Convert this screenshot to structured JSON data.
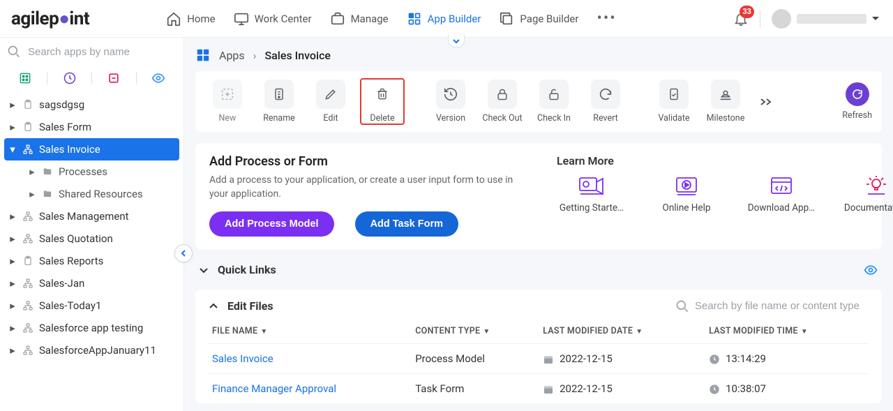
{
  "brand": {
    "name_a": "agilep",
    "name_b": "int"
  },
  "topnav": [
    {
      "key": "home",
      "label": "Home"
    },
    {
      "key": "workcenter",
      "label": "Work Center"
    },
    {
      "key": "manage",
      "label": "Manage"
    },
    {
      "key": "appbuilder",
      "label": "App Builder",
      "active": true
    },
    {
      "key": "pagebuilder",
      "label": "Page Builder"
    }
  ],
  "notifications": {
    "count": "33"
  },
  "sidebar": {
    "search_placeholder": "Search apps by name",
    "items": [
      {
        "label": "sagsdgsg"
      },
      {
        "label": "Sales Form"
      },
      {
        "label": "Sales Invoice",
        "selected": true,
        "expanded": true,
        "children": [
          {
            "label": "Processes"
          },
          {
            "label": "Shared Resources"
          }
        ]
      },
      {
        "label": "Sales Management"
      },
      {
        "label": "Sales Quotation"
      },
      {
        "label": "Sales Reports"
      },
      {
        "label": "Sales-Jan"
      },
      {
        "label": "Sales-Today1"
      },
      {
        "label": "Salesforce app testing"
      },
      {
        "label": "SalesforceAppJanuary11"
      }
    ]
  },
  "breadcrumb": {
    "root": "Apps",
    "current": "Sales Invoice"
  },
  "toolbar": {
    "new": "New",
    "rename": "Rename",
    "edit": "Edit",
    "delete": "Delete",
    "version": "Version",
    "checkout": "Check Out",
    "checkin": "Check In",
    "revert": "Revert",
    "validate": "Validate",
    "milestone": "Milestone",
    "refresh": "Refresh"
  },
  "add_section": {
    "title": "Add Process or Form",
    "desc": "Add a process to your application, or create a user input form to use in your application.",
    "btn_process": "Add Process Model",
    "btn_task": "Add Task Form"
  },
  "learn": {
    "title": "Learn More",
    "items": [
      {
        "label": "Getting Starte…"
      },
      {
        "label": "Online Help"
      },
      {
        "label": "Download App…"
      },
      {
        "label": "Documentation"
      }
    ]
  },
  "quicklinks": {
    "title": "Quick Links"
  },
  "files": {
    "title": "Edit Files",
    "search_placeholder": "Search by file name or content type",
    "cols": {
      "name": "FILE NAME",
      "type": "CONTENT TYPE",
      "date": "LAST MODIFIED DATE",
      "time": "LAST MODIFIED TIME"
    },
    "rows": [
      {
        "name": "Sales Invoice",
        "type": "Process Model",
        "date": "2022-12-15",
        "time": "13:14:29"
      },
      {
        "name": "Finance Manager Approval",
        "type": "Task Form",
        "date": "2022-12-15",
        "time": "10:38:07"
      }
    ]
  }
}
